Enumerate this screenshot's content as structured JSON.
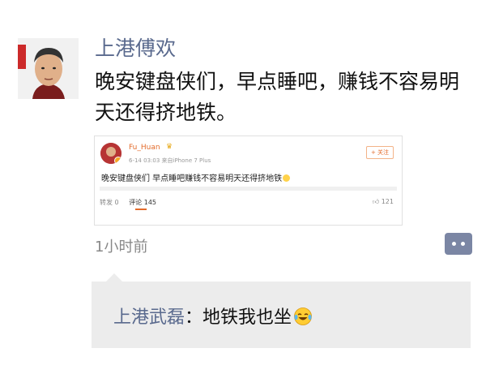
{
  "post": {
    "author": "上港傅欢",
    "text": "晚安键盘侠们，早点睡吧，赚钱不容易明天还得挤地铁。",
    "time": "1小时前"
  },
  "shared_card": {
    "username": "Fu_Huan",
    "meta": "6-14 03:03  来自iPhone 7 Plus",
    "follow_label": "+ 关注",
    "text": "晚安键盘侠们 早点睡吧赚钱不容易明天还得挤地铁",
    "tabs": {
      "repost": "转发 0",
      "comment": "评论 145"
    },
    "likes": "121"
  },
  "comments": [
    {
      "author": "上港武磊",
      "separator": "：",
      "text": "地铁我也坐"
    }
  ],
  "colors": {
    "name_link": "#5a6a8e",
    "comment_button": "#7b86a4",
    "comment_bg": "#ececec",
    "weibo_orange": "#e36b2b"
  },
  "icons": {
    "comment": "comment-dots-icon",
    "emoji": "laughing-tears-emoji"
  }
}
